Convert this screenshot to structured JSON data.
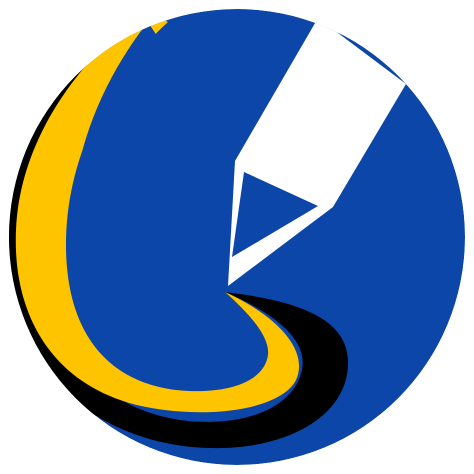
{
  "logo": {
    "icon_name": "pencil-swoosh-icon",
    "colors": {
      "background": "#ffffff",
      "circle": "#0b46a8",
      "pencil": "#ffffff",
      "swoosh_yellow": "#ffc400",
      "swoosh_black": "#000000"
    }
  }
}
